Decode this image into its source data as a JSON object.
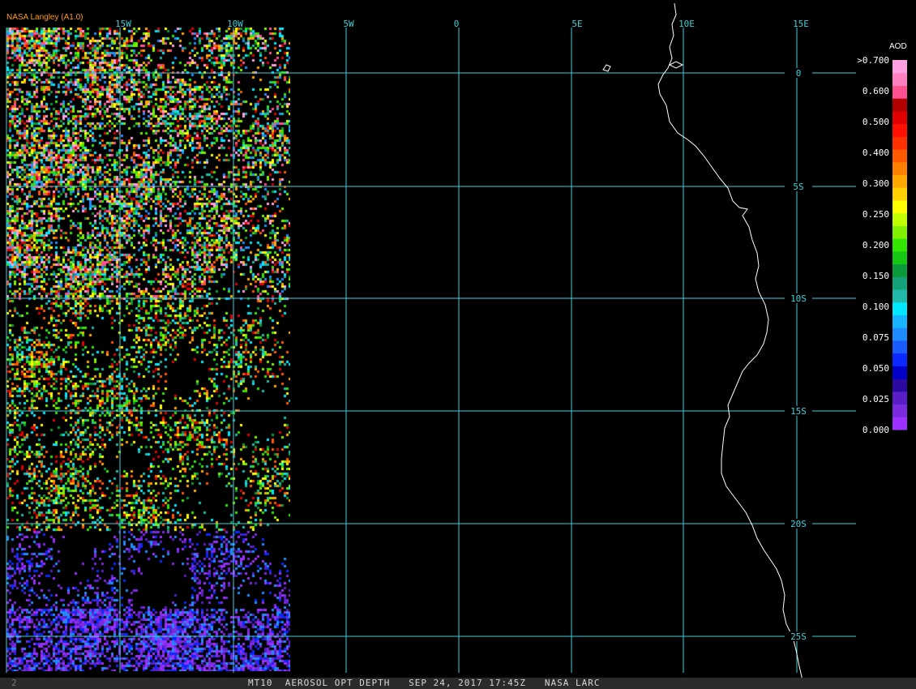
{
  "credit": "NASA Langley (A1.0)",
  "footer": {
    "frame_marker": "2",
    "caption": "MT10  AEROSOL OPT DEPTH   SEP 24, 2017 17:45Z   NASA LARC"
  },
  "grid": {
    "longitude_labels": [
      "15W",
      "10W",
      "5W",
      "0",
      "5E",
      "10E",
      "15E"
    ],
    "latitude_labels": [
      "0",
      "5S",
      "10S",
      "15S",
      "20S",
      "25S"
    ],
    "line_color": "#3fd0d8"
  },
  "legend": {
    "title": "AOD",
    "max_label": ">0.700",
    "tick_labels": [
      "0.600",
      "0.500",
      "0.400",
      "0.300",
      "0.250",
      "0.200",
      "0.150",
      "0.100",
      "0.075",
      "0.050",
      "0.025",
      "0.000"
    ],
    "color_steps": [
      "#9b30ff",
      "#7a2be0",
      "#5a1ec8",
      "#2a0aa0",
      "#0000c8",
      "#0a28ff",
      "#1a5cff",
      "#1e8cff",
      "#18b4ff",
      "#00e8ff",
      "#20b8a8",
      "#14a078",
      "#0a9a3a",
      "#14c814",
      "#32e600",
      "#80f000",
      "#c0ff00",
      "#ffff00",
      "#ffd000",
      "#ffa800",
      "#ff8000",
      "#ff5a00",
      "#ff3000",
      "#ff1000",
      "#e00000",
      "#b00000",
      "#ff5090",
      "#ff80c0",
      "#ffa0e0"
    ]
  },
  "swath_palette": [
    "#9b30ff",
    "#7a2be0",
    "#5a1ec8",
    "#0a28ff",
    "#1e8cff",
    "#00e8ff",
    "#20b8a8",
    "#0a9a3a",
    "#32e600",
    "#80f000",
    "#ffff00",
    "#ffa800",
    "#ff5a00",
    "#e00000",
    "#ff5090",
    "#ffa0e0"
  ],
  "icons": {
    "coastline": "white-coastline-line"
  }
}
